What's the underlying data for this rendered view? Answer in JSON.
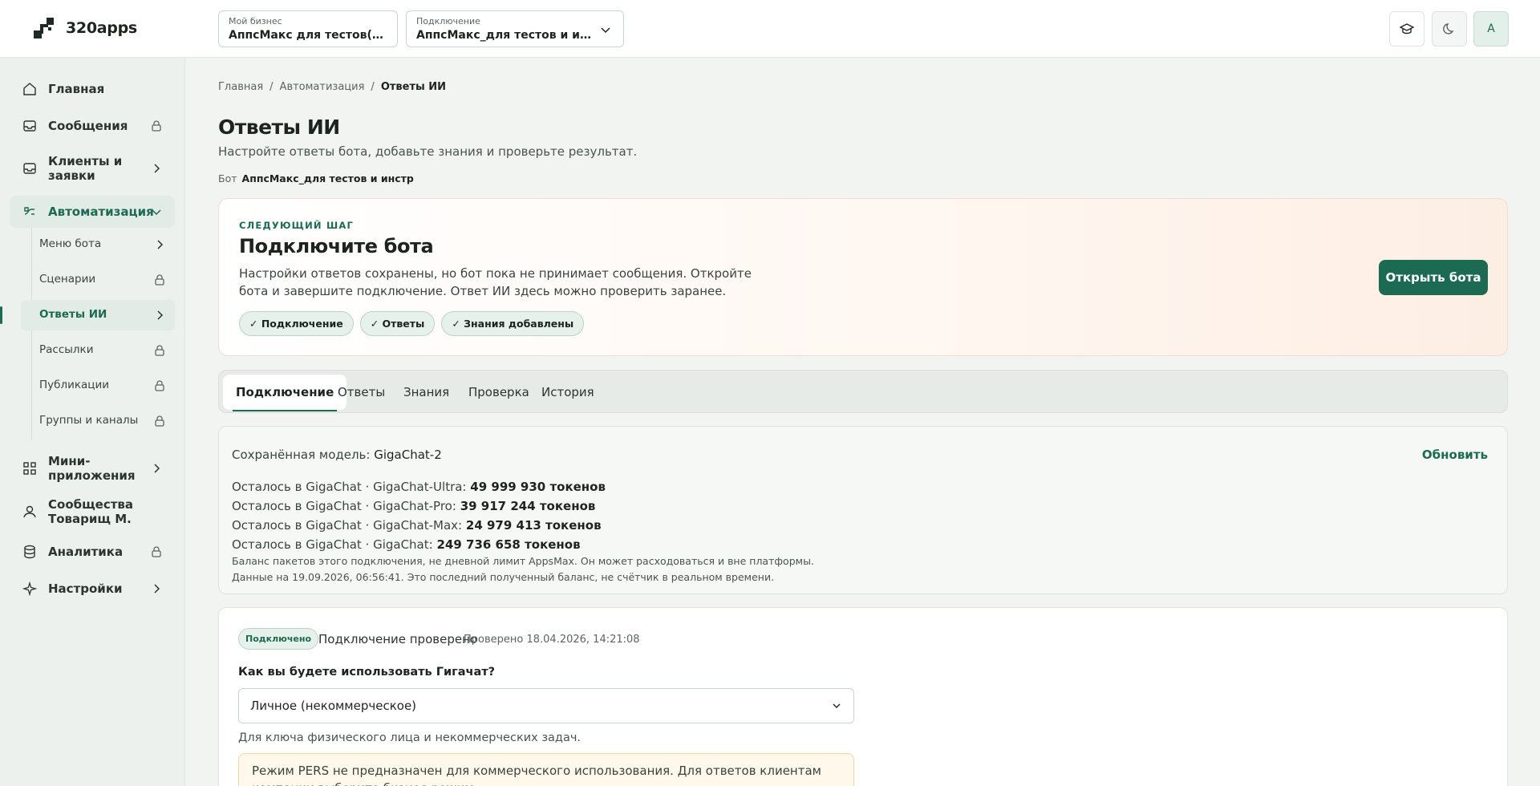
{
  "app": {
    "name": "320apps"
  },
  "header": {
    "business": {
      "label": "Мой бизнес",
      "value": "АппсМакс для тестов(инст..."
    },
    "connection": {
      "label": "Подключение",
      "value": "АппсМакс_для тестов и инстр"
    },
    "avatar": "A"
  },
  "sidebar": {
    "items": [
      {
        "label": "Главная"
      },
      {
        "label": "Сообщения"
      },
      {
        "label": "Клиенты и заявки"
      },
      {
        "label": "Автоматизация"
      },
      {
        "label": "Мини-приложения"
      },
      {
        "label": "Сообщества Товарищ М."
      },
      {
        "label": "Аналитика"
      },
      {
        "label": "Настройки"
      }
    ],
    "sub": [
      {
        "label": "Меню бота"
      },
      {
        "label": "Сценарии"
      },
      {
        "label": "Ответы ИИ"
      },
      {
        "label": "Рассылки"
      },
      {
        "label": "Публикации"
      },
      {
        "label": "Группы и каналы"
      }
    ]
  },
  "breadcrumb": [
    "Главная",
    "Автоматизация",
    "Ответы ИИ"
  ],
  "page": {
    "title": "Ответы ИИ",
    "subtitle": "Настройте ответы бота, добавьте знания и проверьте результат.",
    "bot_label": "Бот",
    "bot_value": "АппсМакс_для тестов и инстр"
  },
  "next_step": {
    "kicker": "СЛЕДУЮЩИЙ ШАГ",
    "title": "Подключите бота",
    "description": "Настройки ответов сохранены, но бот пока не принимает сообщения. Откройте бота и завершите подключение. Ответ ИИ здесь можно проверить заранее.",
    "chips": [
      "✓ Подключение",
      "✓ Ответы",
      "✓ Знания добавлены"
    ],
    "button": "Открыть бота"
  },
  "tabs": [
    "Подключение",
    "Ответы",
    "Знания",
    "Проверка",
    "История"
  ],
  "model": {
    "saved_label": "Сохранённая модель:",
    "saved_value": "GigaChat-2",
    "refresh": "Обновить",
    "tokens": [
      {
        "label": "Осталось в GigaChat · GigaChat-Ultra:",
        "value": "49 999 930 токенов"
      },
      {
        "label": "Осталось в GigaChat · GigaChat-Pro:",
        "value": "39 917 244 токенов"
      },
      {
        "label": "Осталось в GigaChat · GigaChat-Max:",
        "value": "24 979 413 токенов"
      },
      {
        "label": "Осталось в GigaChat · GigaChat:",
        "value": "249 736 658 токенов"
      }
    ],
    "note1": "Баланс пакетов этого подключения, не дневной лимит AppsMax. Он может расходоваться и вне платформы.",
    "note2": "Данные на 19.09.2026, 06:56:41. Это последний полученный баланс, не счётчик в реальном времени."
  },
  "connection": {
    "badge": "Подключено",
    "status": "Подключение проверено",
    "checked": "Проверено 18.04.2026, 14:21:08",
    "question": "Как вы будете использовать Гигачат?",
    "select_value": "Личное (некоммерческое)",
    "helper": "Для ключа физического лица и некоммерческих задач.",
    "warning": "Режим PERS не предназначен для коммерческого использования. Для ответов клиентам компании выберите бизнес-режим."
  },
  "colors": {
    "accent": "#1c6a52",
    "sidebar_bg": "#edf1ed",
    "page_bg": "#f1f4f1"
  }
}
